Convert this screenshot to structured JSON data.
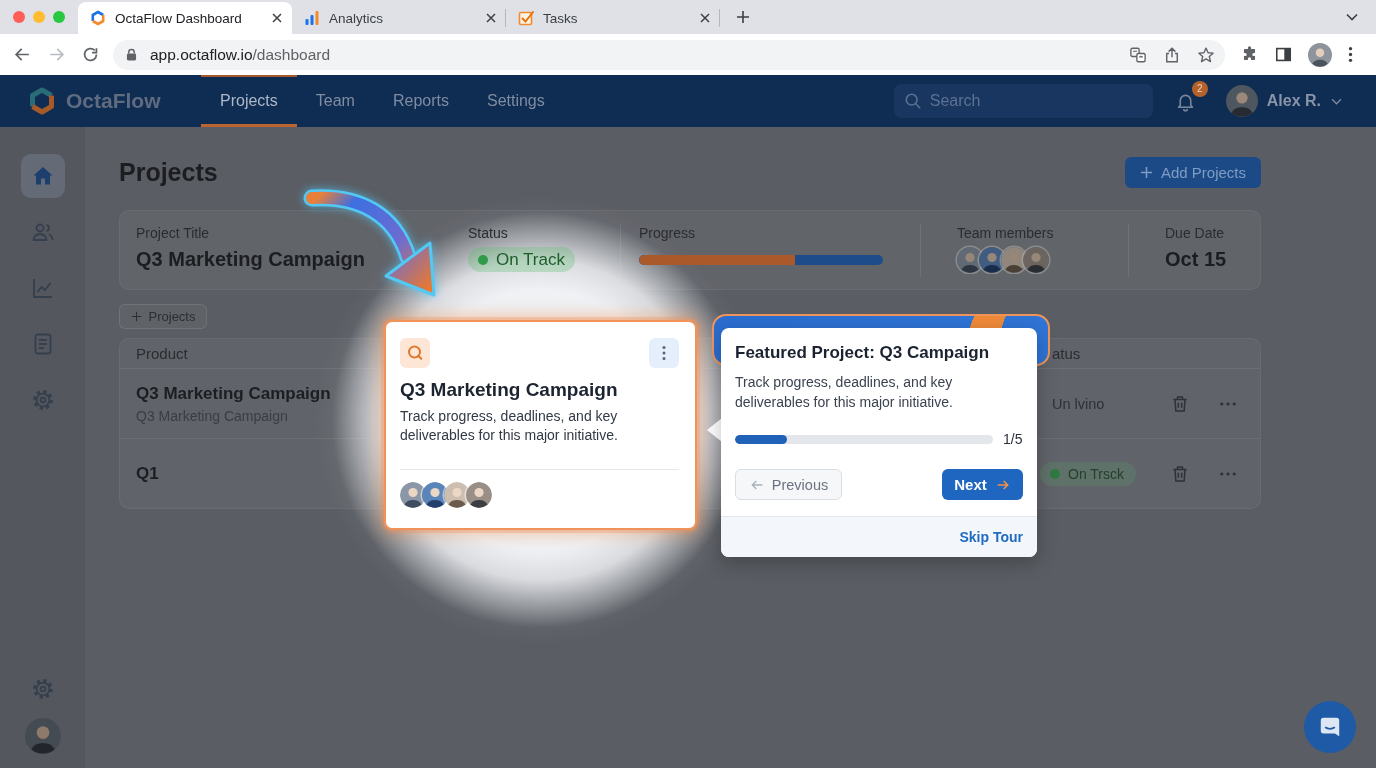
{
  "browser": {
    "tabs": [
      {
        "title": "OctaFlow Dashboard",
        "kind": "app",
        "selected": true
      },
      {
        "title": "Analytics",
        "kind": "analytics",
        "selected": false
      },
      {
        "title": "Tasks",
        "kind": "tasks",
        "selected": false
      }
    ],
    "address": {
      "domain": "app.octaflow.io",
      "path": "/dashboard"
    }
  },
  "header": {
    "logo": "OctaFlow",
    "nav": [
      {
        "label": "Projects",
        "selected": true
      },
      {
        "label": "Team",
        "selected": false
      },
      {
        "label": "Reports",
        "selected": false
      },
      {
        "label": "Settings",
        "selected": false
      }
    ],
    "search": {
      "placeholder": "Search"
    },
    "notifications": "2",
    "user": "Alex R."
  },
  "sidebar": {
    "items": [
      {
        "kind": "home",
        "selected": true
      },
      {
        "kind": "team",
        "selected": false
      },
      {
        "kind": "chart",
        "selected": false
      },
      {
        "kind": "document",
        "selected": false
      },
      {
        "kind": "settings",
        "selected": false
      }
    ]
  },
  "page": {
    "title": "Projects",
    "add_button": "Add Projects"
  },
  "summary": {
    "fields": [
      {
        "kind": "text",
        "label": "Project Title",
        "value": "Q3 Marketing Campaign"
      },
      {
        "kind": "status",
        "label": "Status",
        "value": "On Track"
      },
      {
        "kind": "progress",
        "label": "Progress",
        "level": 0.64
      },
      {
        "kind": "team",
        "label": "Team members"
      },
      {
        "kind": "text",
        "label": "Due Date",
        "value": "Oct 15"
      }
    ]
  },
  "table": {
    "add_button": "Projects",
    "columns": [
      "Product",
      "atus"
    ],
    "rows": [
      {
        "product": "Q3 Marketing Campaign",
        "subtitle": "Q3 Marketing Campaign",
        "status": {
          "kind": "plain",
          "text": "Un lvino"
        }
      },
      {
        "product": "Q1",
        "status": {
          "kind": "pill",
          "text": "On Trsck"
        }
      }
    ]
  },
  "feature_card": {
    "title": "Q3 Marketing Campaign",
    "description": "Track progress, deadlines, and key deliverables for this major initiative."
  },
  "tour": {
    "title": "Featured Project: Q3 Campaign",
    "description": "Track progress, deadlines, and key deliverables for this major initiative.",
    "progress": {
      "level": 0.2
    },
    "step": "1/5",
    "previous": {
      "label": "Previous",
      "disabled": true
    },
    "next": "Next",
    "skip": "Skip Tour"
  }
}
